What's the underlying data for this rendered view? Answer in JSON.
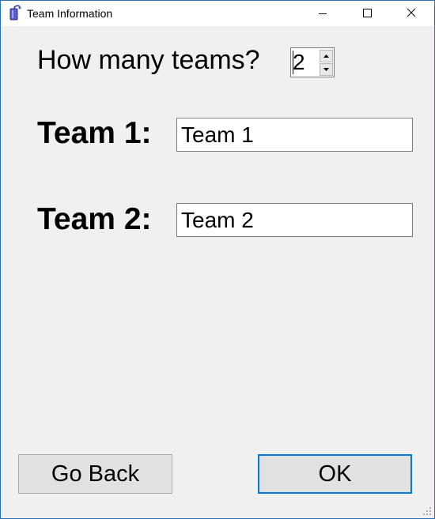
{
  "window": {
    "title": "Team Information",
    "icon": "app-icon"
  },
  "form": {
    "question": "How many teams?",
    "team_count": "2",
    "teams": [
      {
        "label": "Team 1:",
        "value": "Team 1"
      },
      {
        "label": "Team 2:",
        "value": "Team 2"
      }
    ]
  },
  "buttons": {
    "back_label": "Go Back",
    "ok_label": "OK"
  },
  "colors": {
    "accent": "#0078d7",
    "window_border": "#2b6fb0",
    "background": "#f0f0f0"
  }
}
